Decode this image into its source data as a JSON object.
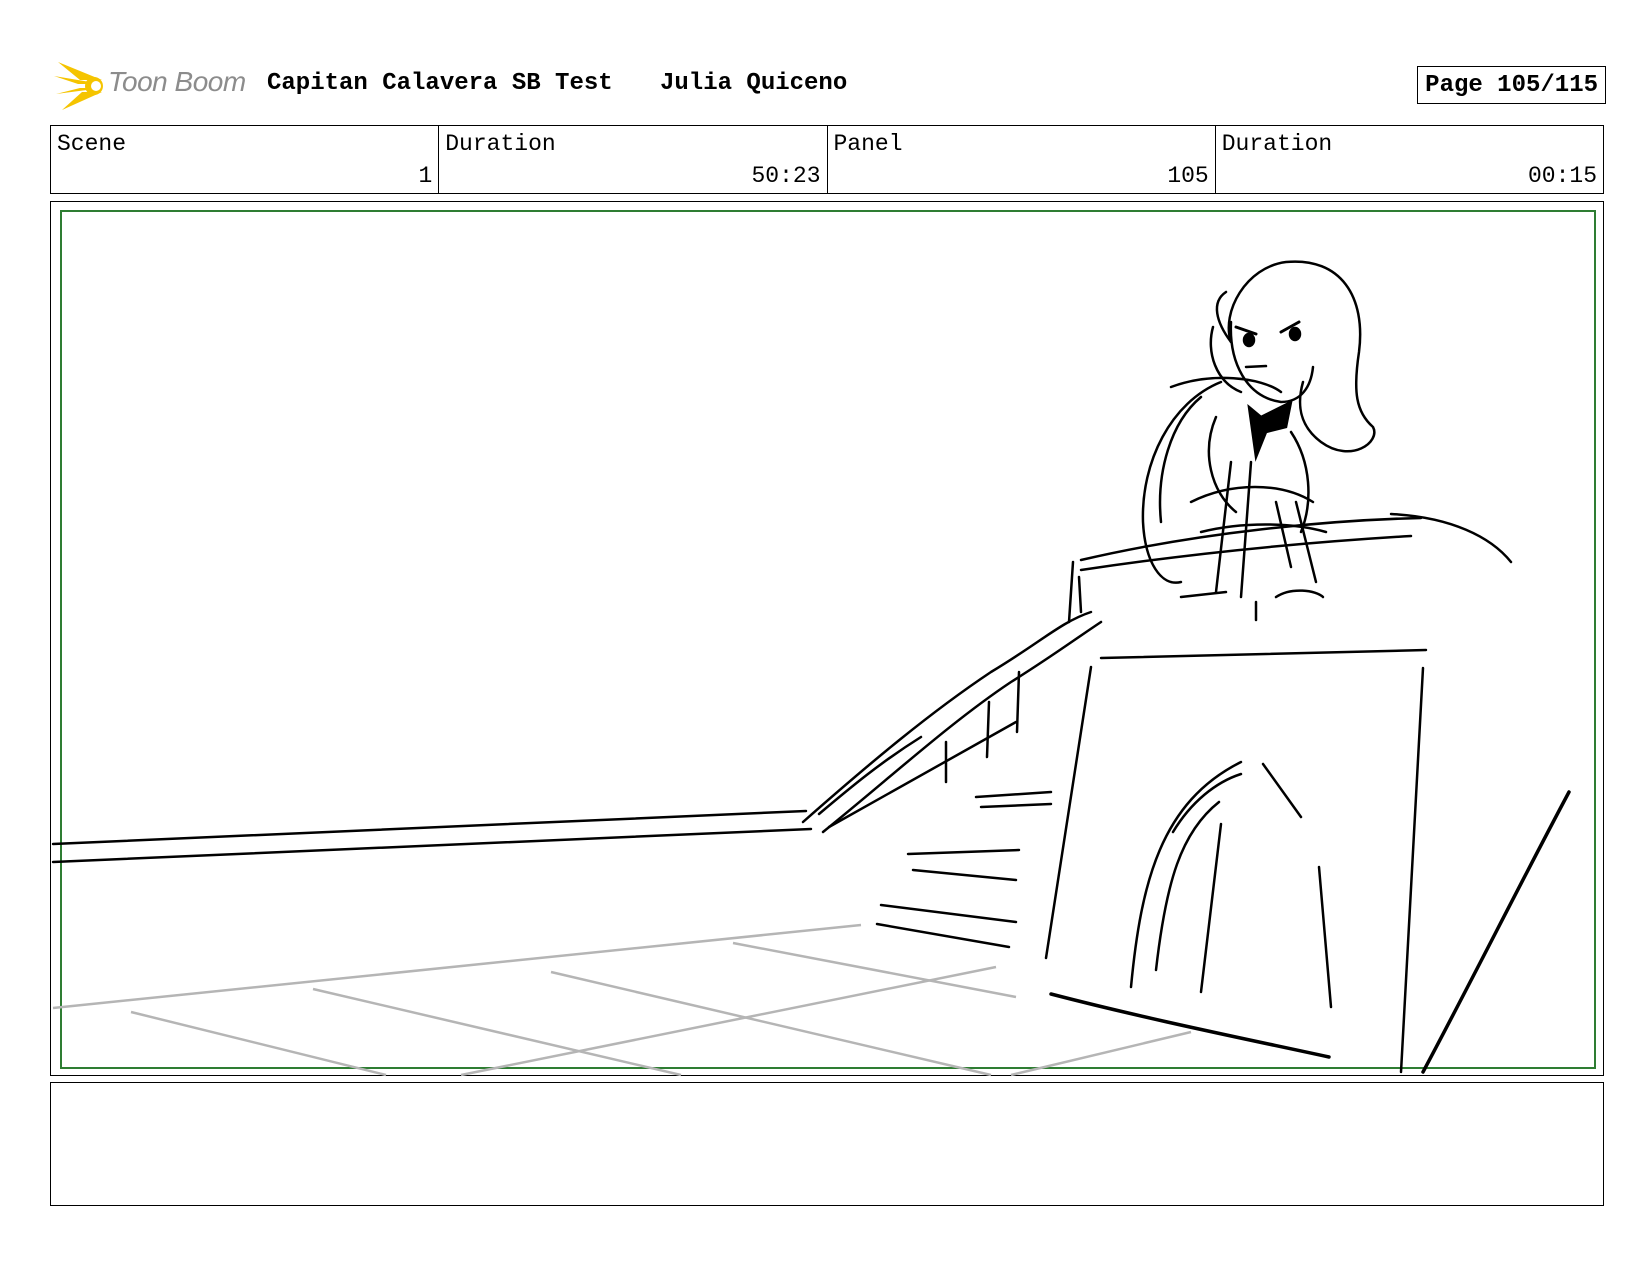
{
  "header": {
    "logo_text": "Toon Boom",
    "project_title": "Capitan Calavera SB Test",
    "author": "Julia Quiceno",
    "page_label": "Page 105/115"
  },
  "info": {
    "scene_label": "Scene",
    "scene_value": "1",
    "scene_duration_label": "Duration",
    "scene_duration_value": "50:23",
    "panel_label": "Panel",
    "panel_value": "105",
    "panel_duration_label": "Duration",
    "panel_duration_value": "00:15"
  },
  "colors": {
    "safe_area": "#2e7d32",
    "logo_accent": "#f5c400",
    "sketch": "#000000",
    "floor_guides": "#b5b5b5"
  },
  "notes": {
    "text": ""
  }
}
